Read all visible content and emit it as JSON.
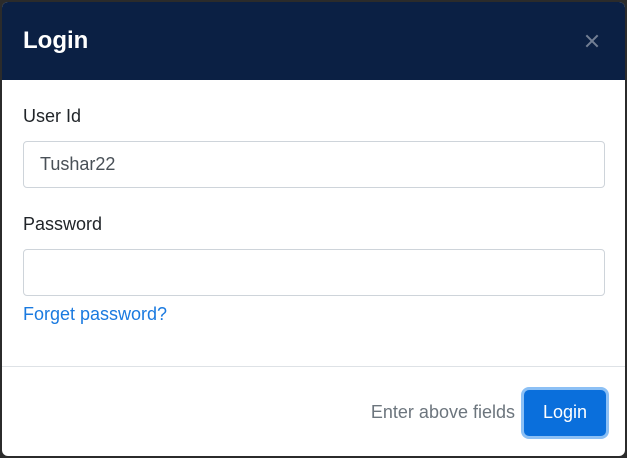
{
  "modal": {
    "title": "Login",
    "close_icon": "close-icon"
  },
  "form": {
    "user_id": {
      "label": "User Id",
      "value": "Tushar22",
      "placeholder": ""
    },
    "password": {
      "label": "Password",
      "value": "",
      "placeholder": ""
    },
    "forget_link": "Forget password?"
  },
  "footer": {
    "hint": "Enter above fields",
    "login_label": "Login"
  },
  "colors": {
    "header_bg": "#0b2044",
    "primary": "#0a6fdc",
    "link": "#1a7ae0"
  }
}
